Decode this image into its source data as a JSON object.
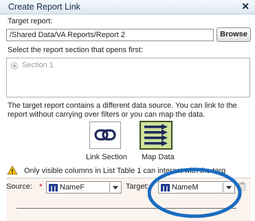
{
  "dialog": {
    "title": "Create Report Link",
    "close_glyph": "✕"
  },
  "target_report": {
    "label": "Target report:",
    "value": "/Shared Data/VA Reports/Report 2",
    "browse_label": "Browse"
  },
  "section_select": {
    "label": "Select the report section that opens first:",
    "options": [
      {
        "label": "Section 1",
        "selected": true
      }
    ]
  },
  "description": "The target report contains a different data source. You can link to the report without carrying over filters or you can map the data.",
  "modes": [
    {
      "label": "Link Section",
      "icon": "chain-link-icon",
      "selected": false
    },
    {
      "label": "Map Data",
      "icon": "map-arrows-icon",
      "selected": true
    }
  ],
  "warning": {
    "icon": "warning-triangle-icon",
    "text": "Only visible columns in List Table 1 can interact with the targ"
  },
  "mapping": {
    "source_label": "Source:",
    "required_marker": "*",
    "source_value": "NameF",
    "target_label": "Target:",
    "target_value": "NameM"
  },
  "colors": {
    "title_bar": "#dde8f3",
    "map_tile": "#cfe19b",
    "annotation_circle": "#1a6cc0",
    "required": "#d0021b"
  }
}
